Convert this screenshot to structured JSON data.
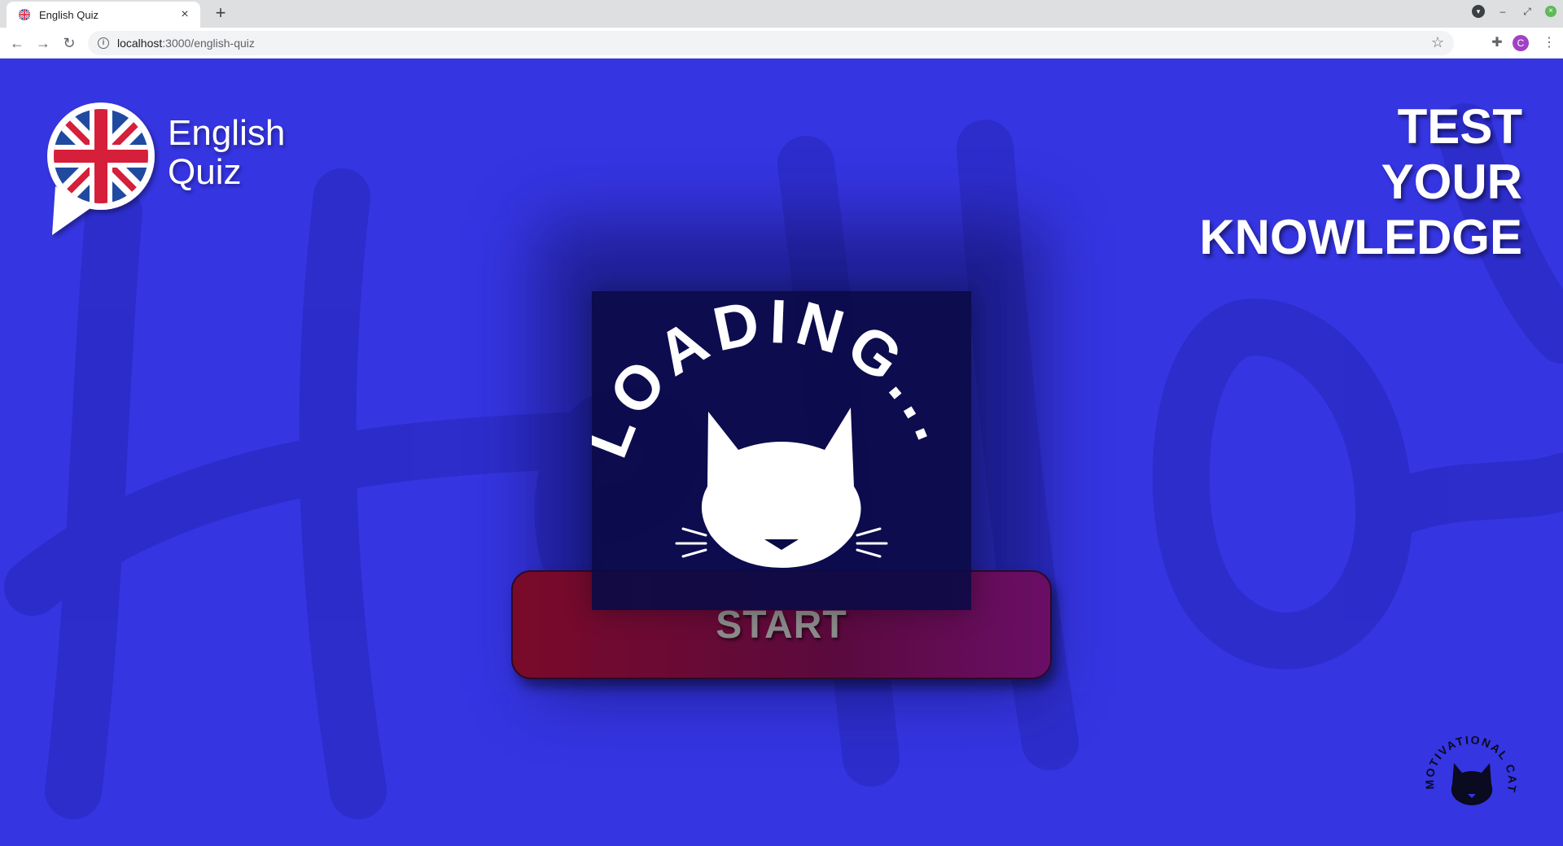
{
  "browser": {
    "tab_title": "English Quiz",
    "tab_close": "×",
    "new_tab": "+",
    "url_host": "localhost",
    "url_path": ":3000/english-quiz",
    "avatar_letter": "C"
  },
  "page": {
    "brand": {
      "line1": "English",
      "line2": "Quiz"
    },
    "tagline": {
      "line1": "TEST",
      "line2": "YOUR",
      "line3": "KNOWLEDGE"
    },
    "loader_text": "LOADING...",
    "start_label": "START",
    "badge_text": "MOTIVATIONAL CAT",
    "background_word": "Hello"
  },
  "colors": {
    "page_bg": "#3535e2",
    "loader_bg": "#0a0a46",
    "button_start": "#7a0a2a",
    "button_end": "#6a0e66",
    "text": "#ffffff"
  }
}
